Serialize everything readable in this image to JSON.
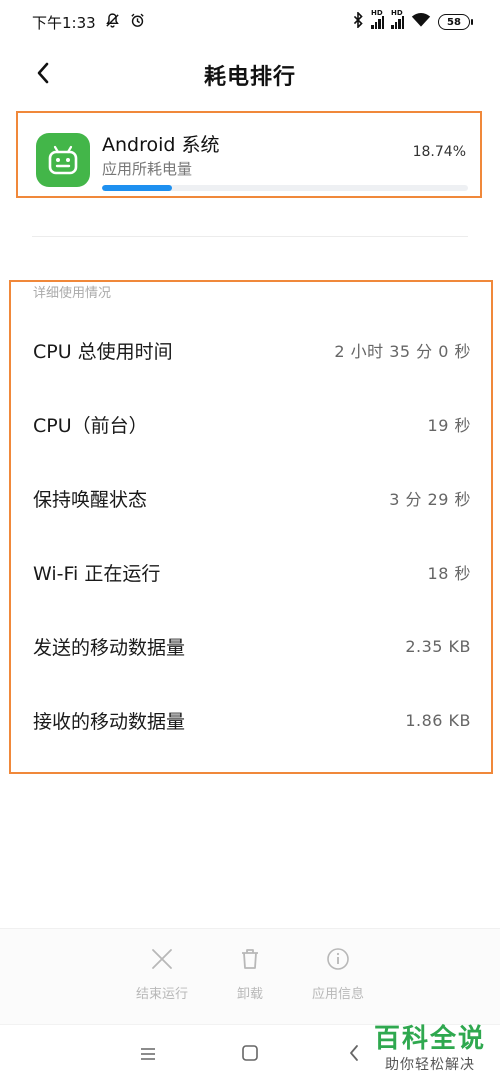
{
  "status_bar": {
    "time": "下午1:33",
    "signal_hd": "HD",
    "battery": "58"
  },
  "header": {
    "title": "耗电排行"
  },
  "app": {
    "name": "Android 系统",
    "subtitle": "应用所耗电量",
    "percent": "18.74%",
    "usage_fraction": 0.19,
    "bar_color": "#1e90f0",
    "icon_color": "#43b649"
  },
  "details": {
    "section_label": "详细使用情况",
    "rows": [
      {
        "label": "CPU 总使用时间",
        "value": "2 小时 35 分 0 秒"
      },
      {
        "label": "CPU（前台）",
        "value": "19 秒"
      },
      {
        "label": "保持唤醒状态",
        "value": "3 分 29 秒"
      },
      {
        "label": "Wi-Fi 正在运行",
        "value": "18 秒"
      },
      {
        "label": "发送的移动数据量",
        "value": "2.35 KB"
      },
      {
        "label": "接收的移动数据量",
        "value": "1.86 KB"
      }
    ]
  },
  "actions": {
    "stop": {
      "label": "结束运行",
      "icon": "close-icon"
    },
    "uninstall": {
      "label": "卸载",
      "icon": "trash-icon"
    },
    "info": {
      "label": "应用信息",
      "icon": "info-icon"
    }
  },
  "watermark": {
    "title": "百科全说",
    "subtitle": "助你轻松解决"
  },
  "highlight_color": "#f0883a"
}
